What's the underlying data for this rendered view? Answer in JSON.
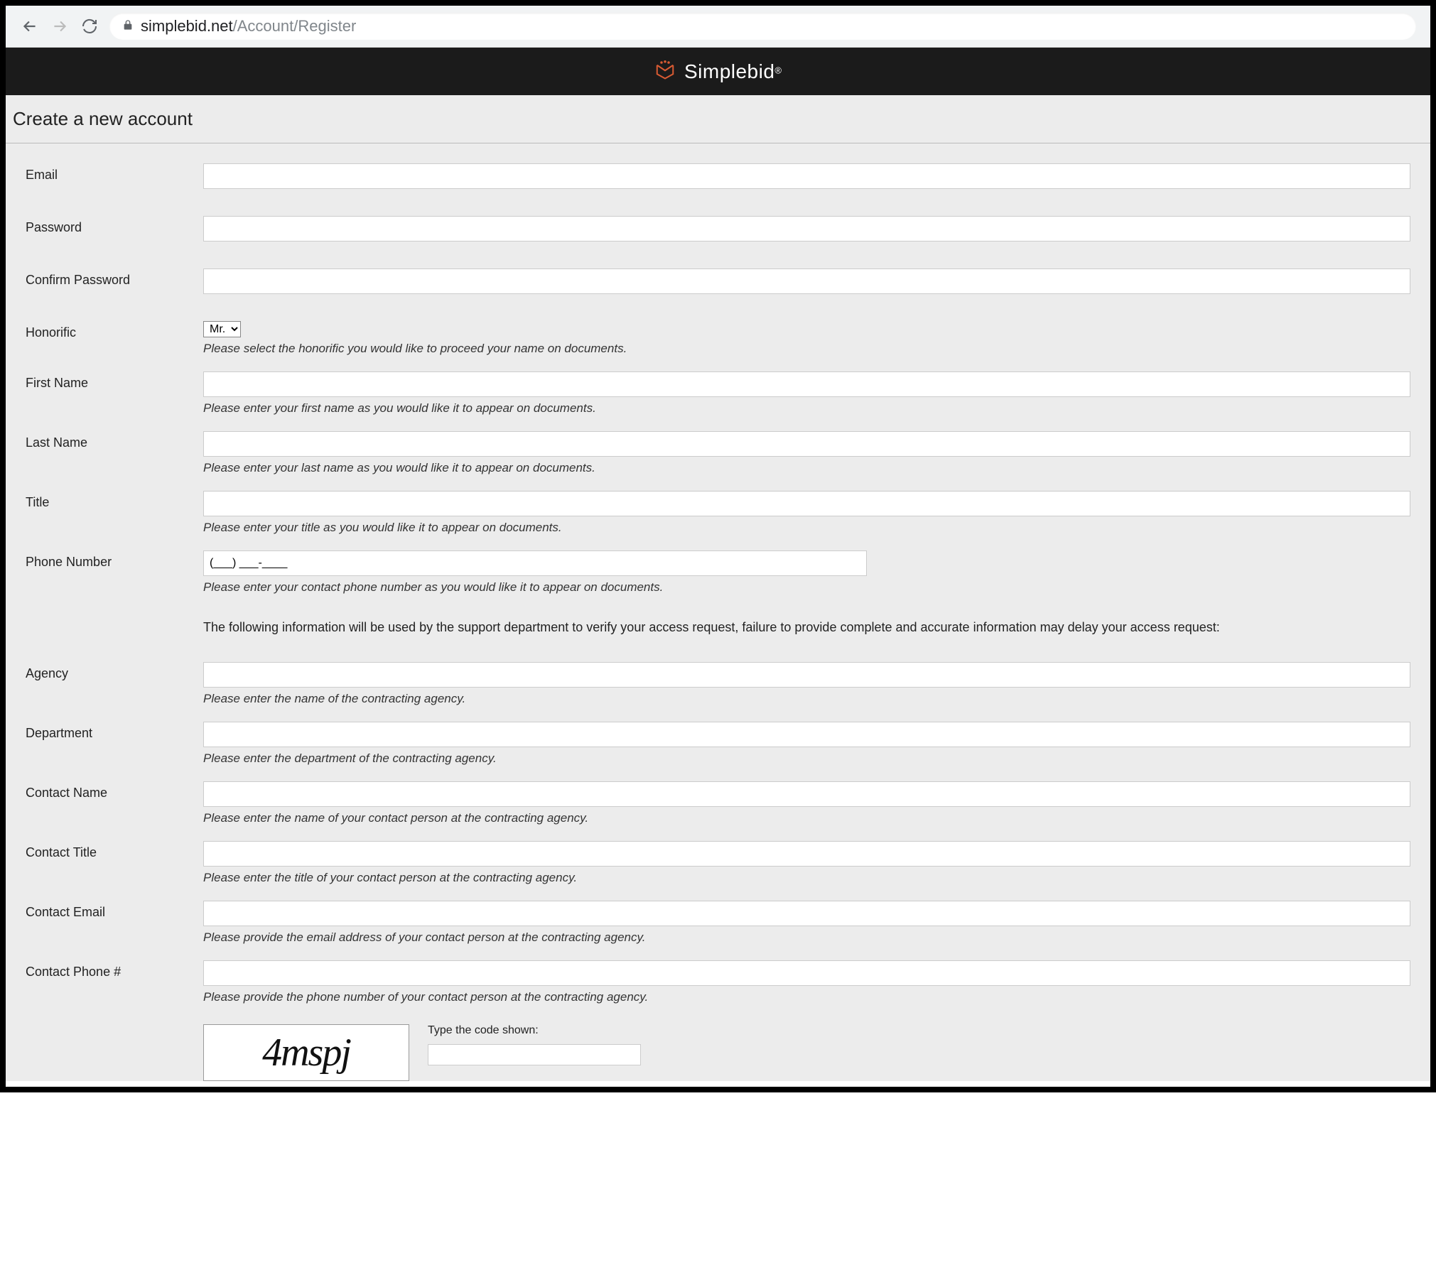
{
  "browser": {
    "url_domain": "simplebid.net",
    "url_path": "/Account/Register"
  },
  "header": {
    "brand": "Simplebid",
    "reg": "®"
  },
  "page": {
    "title": "Create a new account"
  },
  "form": {
    "email": {
      "label": "Email",
      "value": ""
    },
    "password": {
      "label": "Password",
      "value": ""
    },
    "confirm": {
      "label": "Confirm Password",
      "value": ""
    },
    "honorific": {
      "label": "Honorific",
      "selected": "Mr.",
      "hint": "Please select the honorific you would like to proceed your name on documents."
    },
    "first_name": {
      "label": "First Name",
      "value": "",
      "hint": "Please enter your first name as you would like it to appear on documents."
    },
    "last_name": {
      "label": "Last Name",
      "value": "",
      "hint": "Please enter your last name as you would like it to appear on documents."
    },
    "title": {
      "label": "Title",
      "value": "",
      "hint": "Please enter your title as you would like it to appear on documents."
    },
    "phone": {
      "label": "Phone Number",
      "value": "(___) ___-____",
      "hint": "Please enter your contact phone number as you would like it to appear on documents."
    },
    "info": "The following information will be used by the support department to verify your access request, failure to provide complete and accurate information may delay your access request:",
    "agency": {
      "label": "Agency",
      "value": "",
      "hint": "Please enter the name of the contracting agency."
    },
    "department": {
      "label": "Department",
      "value": "",
      "hint": "Please enter the department of the contracting agency."
    },
    "contact_name": {
      "label": "Contact Name",
      "value": "",
      "hint": "Please enter the name of your contact person at the contracting agency."
    },
    "contact_title": {
      "label": "Contact Title",
      "value": "",
      "hint": "Please enter the title of your contact person at the contracting agency."
    },
    "contact_email": {
      "label": "Contact Email",
      "value": "",
      "hint": "Please provide the email address of your contact person at the contracting agency."
    },
    "contact_phone": {
      "label": "Contact Phone #",
      "value": "",
      "hint": "Please provide the phone number of your contact person at the contracting agency."
    },
    "captcha": {
      "code": "4mspj",
      "label": "Type the code shown:",
      "value": ""
    }
  }
}
